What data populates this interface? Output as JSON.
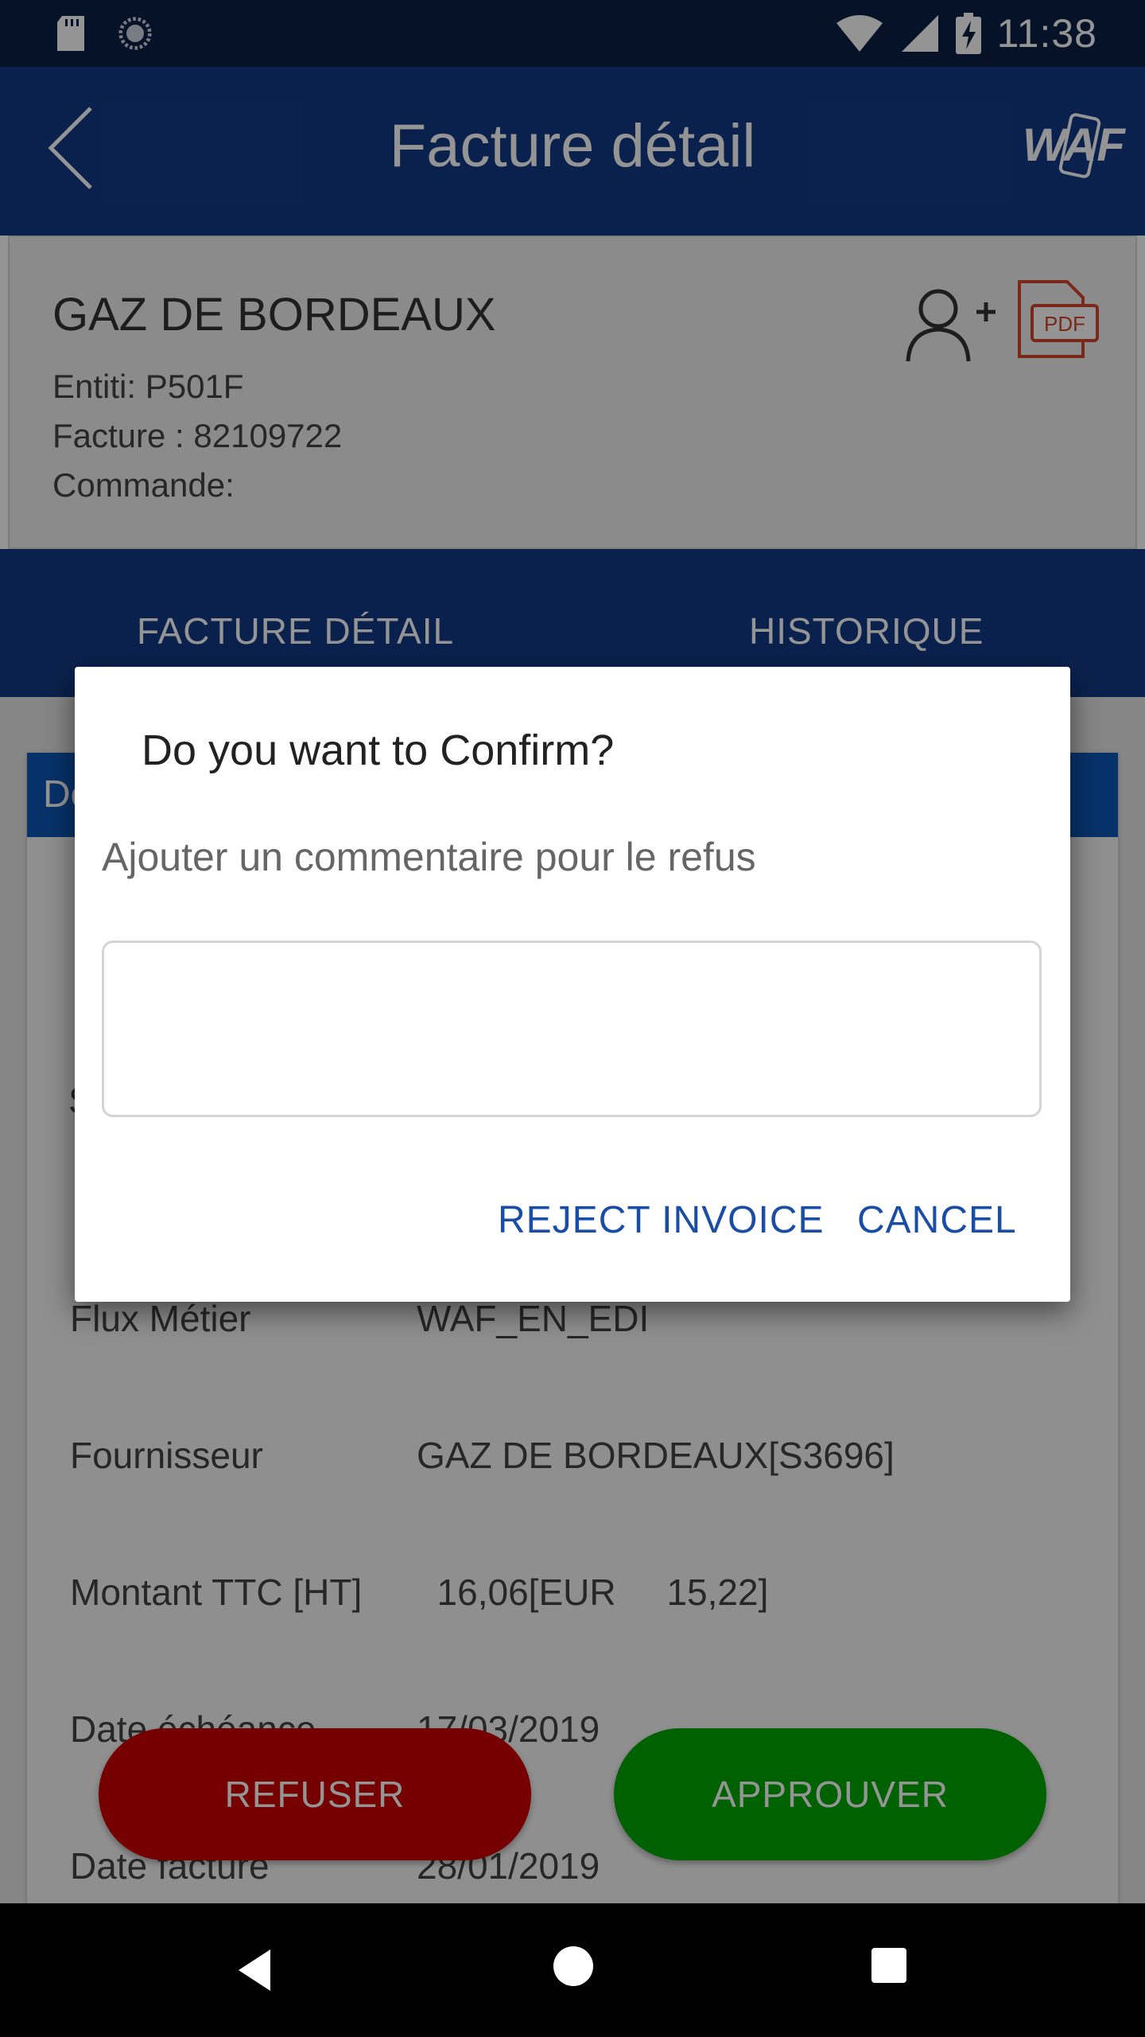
{
  "status_bar": {
    "time": "11:38",
    "icons": [
      "sd-card-icon",
      "sync-icon",
      "wifi-icon",
      "signal-icon",
      "battery-charging-icon"
    ]
  },
  "app_bar": {
    "title": "Facture détail",
    "back_icon": "chevron-left-icon",
    "logo_text": "WAF"
  },
  "invoice_card": {
    "vendor": "GAZ DE BORDEAUX",
    "entity": "Entiti: P501F",
    "invoice": "Facture : 82109722",
    "order": "Commande:",
    "pdf_label": "PDF"
  },
  "tabs": [
    {
      "label": "FACTURE DÉTAIL"
    },
    {
      "label": "HISTORIQUE"
    }
  ],
  "detail": {
    "section_title_partial": "De",
    "partial_row_label": "S",
    "rows": [
      {
        "label": "Flux Métier",
        "value": "WAF_EN_EDI"
      },
      {
        "label": "Fournisseur",
        "value": "GAZ DE BORDEAUX[S3696]"
      },
      {
        "label": "Montant TTC [HT]",
        "value": "  16,06[EUR     15,22]"
      },
      {
        "label": "Date échéance",
        "value": "17/03/2019"
      },
      {
        "label": "Date facture",
        "value": "28/01/2019"
      }
    ]
  },
  "actions": {
    "refuse": "REFUSER",
    "approve": "APPROUVER"
  },
  "dialog": {
    "title": "Do you want to Confirm?",
    "message": "Ajouter un commentaire pour le refus",
    "input_value": "",
    "reject_label": "REJECT INVOICE",
    "cancel_label": "CANCEL"
  },
  "colors": {
    "primary": "#133a86",
    "status_bar": "#0b1f46",
    "refuse": "#cc0000",
    "approve": "#00a800",
    "dialog_button": "#1a4ea6"
  }
}
